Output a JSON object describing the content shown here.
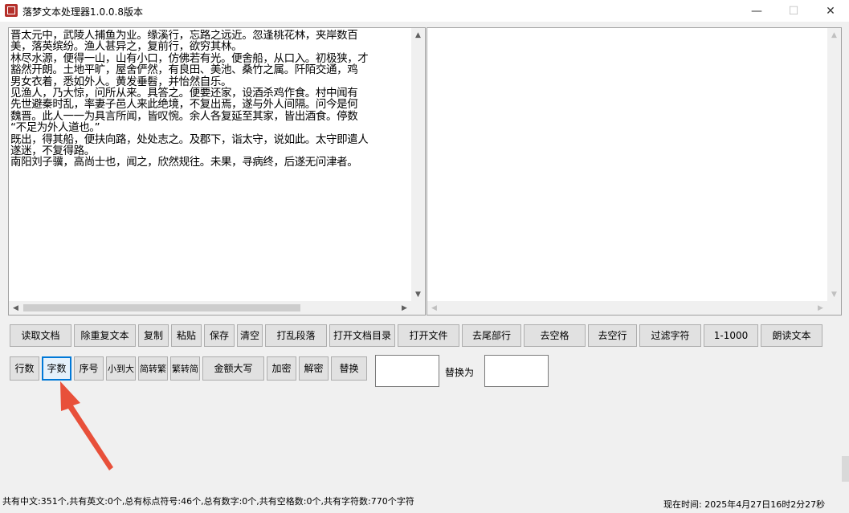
{
  "window": {
    "title": "落梦文本处理器1.0.0.8版本",
    "min_glyph": "—",
    "max_glyph": "☐",
    "close_glyph": "✕"
  },
  "left_pane": {
    "text": "晋太元中，武陵人捕鱼为业。缘溪行，忘路之远近。忽逢桃花林，夹岸数百\n美，落英缤纷。渔人甚异之，复前行，欲穷其林。\n林尽水源，便得一山，山有小口，仿佛若有光。便舍船，从口入。初极狭，才\n豁然开朗。土地平旷，屋舍俨然，有良田、美池、桑竹之属。阡陌交通，鸡\n男女衣着，悉如外人。黄发垂髫，并怡然自乐。\n见渔人，乃大惊，问所从来。具答之。便要还家，设酒杀鸡作食。村中闻有\n先世避秦时乱，率妻子邑人来此绝境，不复出焉，遂与外人间隔。问今是何\n魏晋。此人一一为具言所闻，皆叹惋。余人各复延至其家，皆出酒食。停数\n“不足为外人道也。”\n既出，得其船，便扶向路，处处志之。及郡下，诣太守，说如此。太守即遣人\n遂迷，不复得路。\n南阳刘子骥，高尚士也，闻之，欣然规往。未果，寻病终，后遂无问津者。"
  },
  "right_pane": {
    "text": ""
  },
  "toolbar_row1": [
    {
      "label": "读取文档"
    },
    {
      "label": "除重复文本"
    },
    {
      "label": "复制"
    },
    {
      "label": "粘贴"
    },
    {
      "label": "保存"
    },
    {
      "label": "清空"
    },
    {
      "label": "打乱段落"
    },
    {
      "label": "打开文档目录"
    },
    {
      "label": "打开文件"
    },
    {
      "label": "去尾部行"
    },
    {
      "label": "去空格"
    },
    {
      "label": "去空行"
    },
    {
      "label": "过滤字符"
    },
    {
      "label": "1-1000"
    },
    {
      "label": "朗读文本"
    }
  ],
  "toolbar_row2": [
    {
      "label": "行数"
    },
    {
      "label": "字数"
    },
    {
      "label": "序号"
    },
    {
      "label": "小到大"
    },
    {
      "label": "简转繁"
    },
    {
      "label": "繁转简"
    },
    {
      "label": "金额大写"
    },
    {
      "label": "加密"
    },
    {
      "label": "解密"
    },
    {
      "label": "替换"
    }
  ],
  "replace": {
    "find_value": "",
    "label": "替换为",
    "replace_value": ""
  },
  "status": {
    "stats": "共有中文:351个,共有英文:0个,总有标点符号:46个,总有数字:0个,共有空格数:0个,共有字符数:770个字符",
    "clock": "现在时间: 2025年4月27日16时2分27秒"
  },
  "colors": {
    "annotation_arrow": "#e8503a",
    "selection": "#0078d7",
    "app_icon": "#b5302b"
  }
}
